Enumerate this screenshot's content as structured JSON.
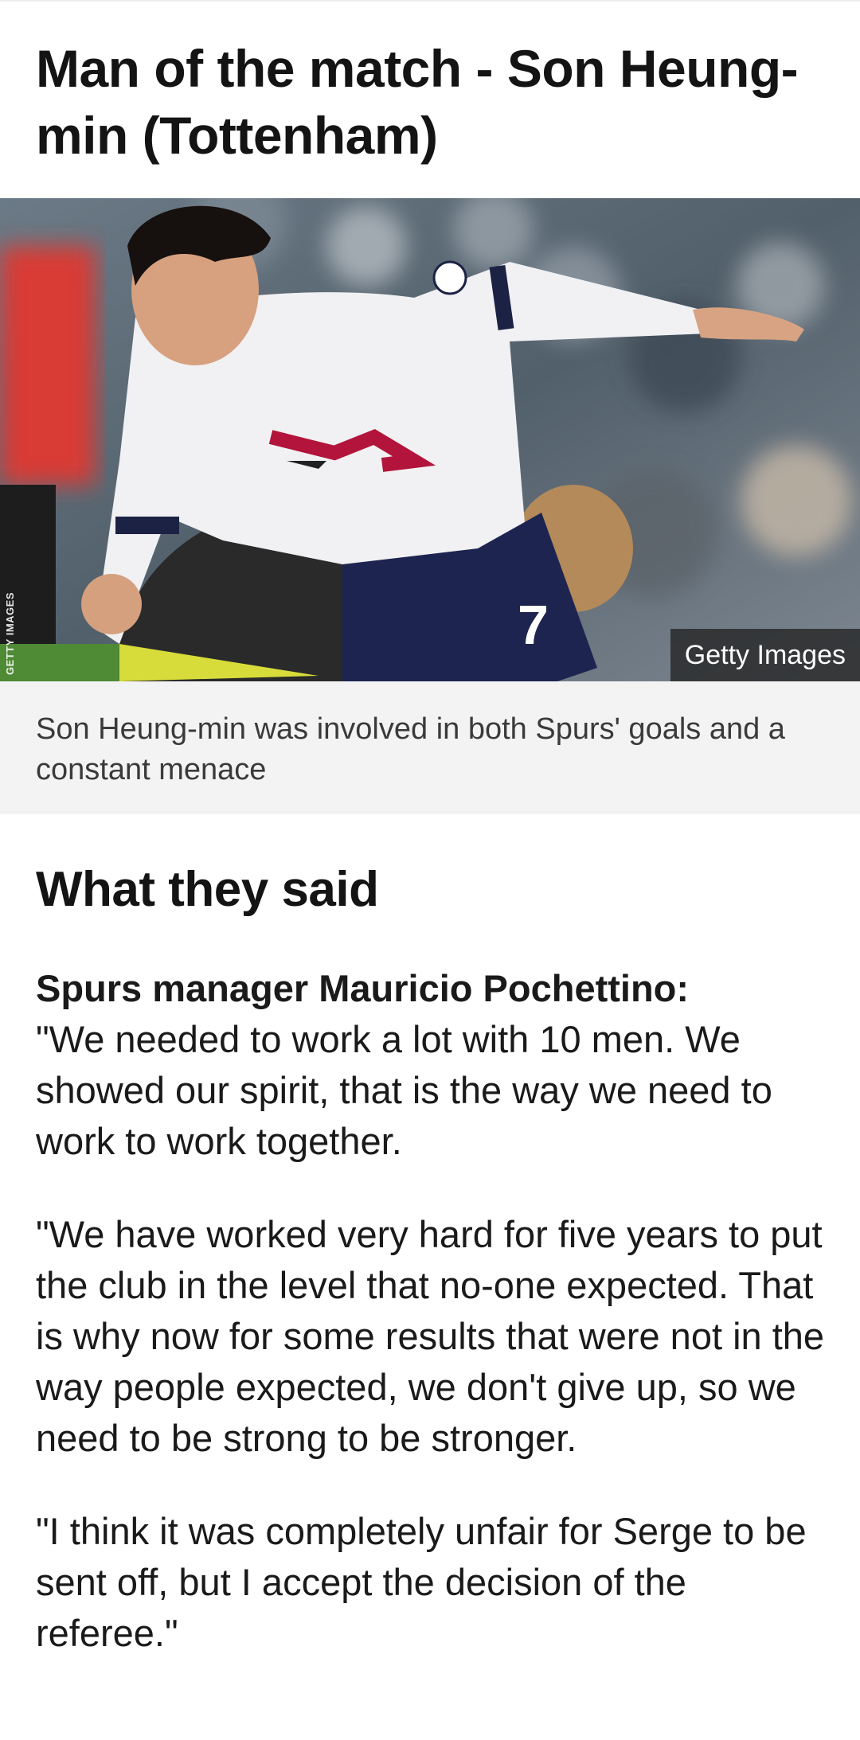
{
  "article": {
    "headline": "Man of the match - Son Heung-min (Tottenham)",
    "image": {
      "agency_tag": "GETTY IMAGES",
      "credit": "Getty Images",
      "caption": "Son Heung-min was involved in both Spurs' goals and a constant menace",
      "shirt_number": "7"
    },
    "section_title": "What they said",
    "quotes": [
      {
        "speaker": "Spurs manager Mauricio Pochettino:",
        "text": "\"We needed to work a lot with 10 men. We showed our spirit, that is the way we need to work to work together."
      },
      {
        "text": "\"We have worked very hard for five years to put the club in the level that no-one expected. That is why now for some results that were not in the way people expected, we don't give up, so we need to be strong to be stronger."
      },
      {
        "text": "\"I think it was completely unfair for Serge to be sent off, but I accept the decision of the referee.\""
      }
    ]
  }
}
